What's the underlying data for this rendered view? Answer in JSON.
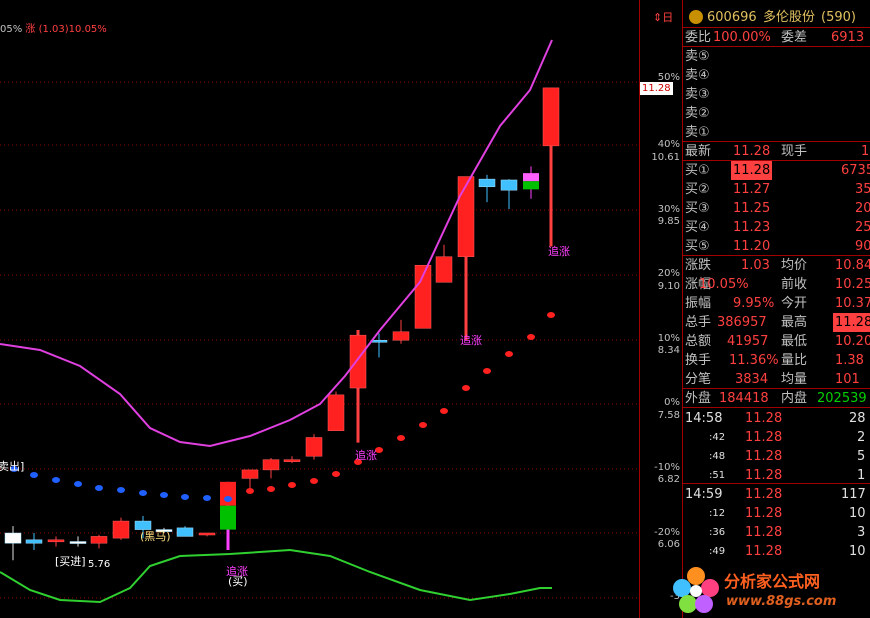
{
  "header": {
    "stock_code": "600696",
    "stock_name": "多伦股份",
    "stock_num": "(590)",
    "indicator_line_prefix": "05%",
    "indicator_line": "涨 (1.03)10.05%",
    "corner_icons": "⇕日"
  },
  "colors": {
    "up": "#ff4040",
    "down": "#00d000",
    "grid": "#a00000",
    "bg": "#000000"
  },
  "axis": {
    "percent_labels": [
      "50%",
      "40%",
      "30%",
      "20%",
      "10%",
      "0%",
      "-10%",
      "-20%",
      "-3"
    ],
    "price_labels": [
      "10.61",
      "9.85",
      "9.10",
      "8.34",
      "7.58",
      "6.82",
      "6.06"
    ],
    "current_price_tag": "11.28"
  },
  "chart_data": {
    "type": "candlestick",
    "candles": [
      {
        "o": 5.94,
        "h": 6.14,
        "l": 5.74,
        "c": 6.06,
        "color": "white"
      },
      {
        "o": 5.98,
        "h": 6.06,
        "l": 5.86,
        "c": 5.94,
        "color": "cyan"
      },
      {
        "o": 5.96,
        "h": 6.02,
        "l": 5.9,
        "c": 5.98,
        "color": "red"
      },
      {
        "o": 5.96,
        "h": 6.02,
        "l": 5.9,
        "c": 5.96,
        "color": "white"
      },
      {
        "o": 5.94,
        "h": 6.04,
        "l": 5.88,
        "c": 6.02,
        "color": "red"
      },
      {
        "o": 6.0,
        "h": 6.24,
        "l": 5.98,
        "c": 6.2,
        "color": "red"
      },
      {
        "o": 6.2,
        "h": 6.26,
        "l": 6.0,
        "c": 6.1,
        "color": "cyan"
      },
      {
        "o": 6.1,
        "h": 6.12,
        "l": 6.06,
        "c": 6.1,
        "color": "white"
      },
      {
        "o": 6.12,
        "h": 6.14,
        "l": 6.02,
        "c": 6.02,
        "color": "cyan"
      },
      {
        "o": 6.04,
        "h": 6.06,
        "l": 6.02,
        "c": 6.06,
        "color": "red"
      },
      {
        "o": 6.1,
        "h": 6.66,
        "l": 5.86,
        "c": 6.66,
        "color": "redgreen"
      },
      {
        "o": 6.7,
        "h": 6.8,
        "l": 6.58,
        "c": 6.8,
        "color": "red"
      },
      {
        "o": 6.8,
        "h": 6.94,
        "l": 6.7,
        "c": 6.92,
        "color": "red"
      },
      {
        "o": 6.92,
        "h": 6.96,
        "l": 6.88,
        "c": 6.92,
        "color": "red"
      },
      {
        "o": 6.96,
        "h": 7.22,
        "l": 6.92,
        "c": 7.18,
        "color": "red"
      },
      {
        "o": 7.26,
        "h": 7.72,
        "l": 7.26,
        "c": 7.68,
        "color": "red"
      },
      {
        "o": 7.76,
        "h": 8.44,
        "l": 7.12,
        "c": 8.38,
        "color": "red"
      },
      {
        "o": 8.32,
        "h": 8.4,
        "l": 8.12,
        "c": 8.32,
        "color": "blue"
      },
      {
        "o": 8.32,
        "h": 8.56,
        "l": 8.28,
        "c": 8.42,
        "color": "red"
      },
      {
        "o": 8.46,
        "h": 9.2,
        "l": 8.46,
        "c": 9.2,
        "color": "red"
      },
      {
        "o": 9.0,
        "h": 9.44,
        "l": 9.0,
        "c": 9.3,
        "color": "red"
      },
      {
        "o": 9.3,
        "h": 10.24,
        "l": 8.32,
        "c": 10.24,
        "color": "red"
      },
      {
        "o": 10.21,
        "h": 10.26,
        "l": 9.94,
        "c": 10.12,
        "color": "blue"
      },
      {
        "o": 10.08,
        "h": 10.21,
        "l": 9.86,
        "c": 10.2,
        "color": "blue"
      },
      {
        "o": 10.09,
        "h": 10.36,
        "l": 9.98,
        "c": 10.28,
        "color": "pinkgreen"
      },
      {
        "o": 10.6,
        "h": 11.28,
        "l": 9.42,
        "c": 11.28,
        "color": "red"
      }
    ],
    "labels": [
      {
        "text": "卖出]",
        "color": "#ffffff"
      },
      {
        "text": "[买进]",
        "color": "#ffffff"
      },
      {
        "text": "5.76",
        "color": "#ffffff"
      },
      {
        "text": "(黑马)",
        "color": "#ffe080"
      },
      {
        "text": "追涨",
        "color": "#ff40ff"
      },
      {
        "text": "(买)",
        "color": "#ffffff"
      },
      {
        "text": "追涨",
        "color": "#ff40ff"
      },
      {
        "text": "追涨",
        "color": "#ff40ff"
      },
      {
        "text": "追涨",
        "color": "#ff40ff"
      }
    ]
  },
  "quote": {
    "weibi_label": "委比",
    "weibi_value": "100.00%",
    "weicha_label": "委差",
    "weicha_value": "6913",
    "sells": [
      {
        "label": "卖⑤"
      },
      {
        "label": "卖④"
      },
      {
        "label": "卖③"
      },
      {
        "label": "卖②"
      },
      {
        "label": "卖①"
      }
    ],
    "latest_label": "最新",
    "latest_value": "11.28",
    "xianshou_label": "现手",
    "xianshou_value": "1",
    "buys": [
      {
        "label": "买①",
        "price": "11.28",
        "vol": "6735"
      },
      {
        "label": "买②",
        "price": "11.27",
        "vol": "35"
      },
      {
        "label": "买③",
        "price": "11.25",
        "vol": "20"
      },
      {
        "label": "买④",
        "price": "11.23",
        "vol": "25"
      },
      {
        "label": "买⑤",
        "price": "11.20",
        "vol": "90"
      }
    ],
    "stats": [
      {
        "l1": "涨跌",
        "v1": "1.03",
        "l2": "均价",
        "v2": "10.84"
      },
      {
        "l1": "涨幅",
        "v1": "10.05%",
        "l2": "前收",
        "v2": "10.25"
      },
      {
        "l1": "振幅",
        "v1": "9.95%",
        "l2": "今开",
        "v2": "10.37"
      },
      {
        "l1": "总手",
        "v1": "386957",
        "l2": "最高",
        "v2": "11.28"
      },
      {
        "l1": "总额",
        "v1": "41957",
        "l2": "最低",
        "v2": "10.20"
      },
      {
        "l1": "换手",
        "v1": "11.36%",
        "l2": "量比",
        "v2": "1.38"
      },
      {
        "l1": "分笔",
        "v1": "3834",
        "l2": "均量",
        "v2": "101"
      }
    ],
    "waipan_label": "外盘",
    "waipan_value": "184418",
    "neipan_label": "内盘",
    "neipan_value": "202539"
  },
  "ticks": [
    {
      "time": "14:58",
      "price": "11.28",
      "vol": "28"
    },
    {
      "time": ":42",
      "price": "11.28",
      "vol": "2"
    },
    {
      "time": ":48",
      "price": "11.28",
      "vol": "5"
    },
    {
      "time": ":51",
      "price": "11.28",
      "vol": "1"
    },
    {
      "time": "14:59",
      "price": "11.28",
      "vol": "117"
    },
    {
      "time": ":12",
      "price": "11.28",
      "vol": "10"
    },
    {
      "time": ":36",
      "price": "11.28",
      "vol": "3"
    },
    {
      "time": ":49",
      "price": "11.28",
      "vol": "10"
    }
  ],
  "watermark": {
    "text": "分析家公式网",
    "url": "www.88gs.com"
  }
}
